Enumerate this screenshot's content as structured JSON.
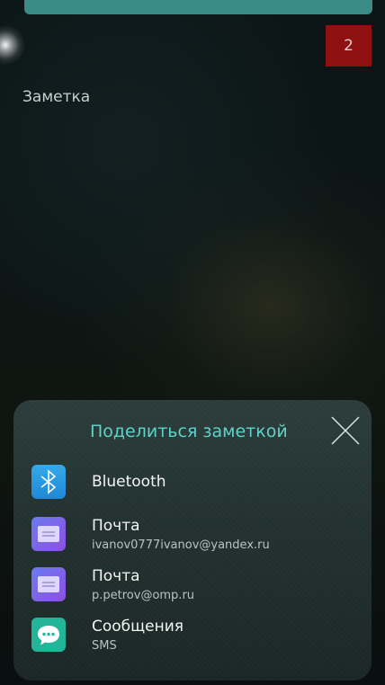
{
  "background": {
    "accent": "#3b8c86",
    "badge_color": "#8f1010"
  },
  "note": {
    "title": "Заметка",
    "count": "2"
  },
  "share": {
    "title": "Поделиться заметкой",
    "close_icon": "close-icon",
    "title_color": "#5fd3ca",
    "options": [
      {
        "icon": "bluetooth-icon",
        "label": "Bluetooth",
        "sub": ""
      },
      {
        "icon": "mail-icon",
        "label": "Почта",
        "sub": "ivanov0777ivanov@yandex.ru"
      },
      {
        "icon": "mail-icon",
        "label": "Почта",
        "sub": "p.petrov@omp.ru"
      },
      {
        "icon": "messages-icon",
        "label": "Сообщения",
        "sub": "SMS"
      }
    ]
  }
}
